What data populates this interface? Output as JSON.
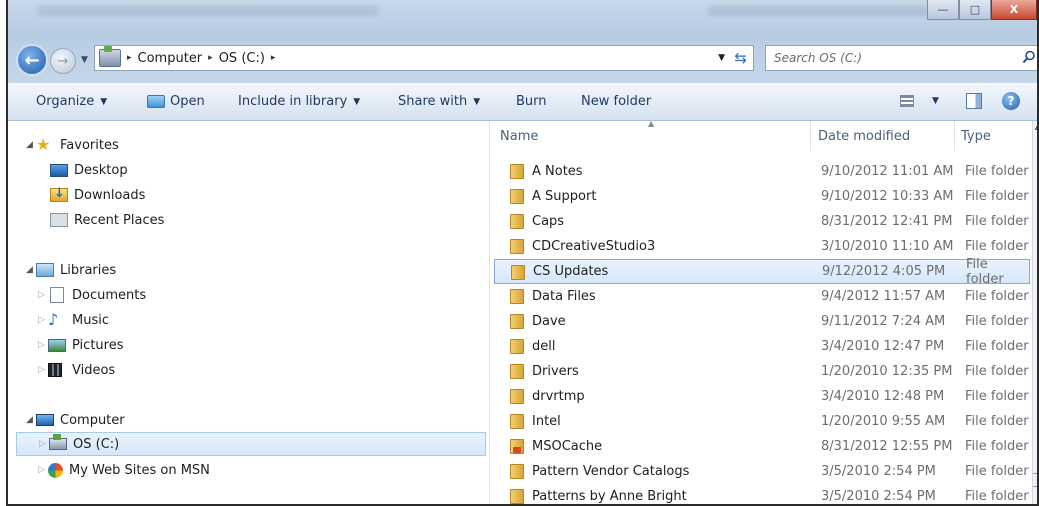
{
  "window": {
    "controls": {
      "minimize": "—",
      "maximize": "□",
      "close": "X"
    }
  },
  "address": {
    "breadcrumbs": [
      "Computer",
      "OS (C:)"
    ],
    "separator": "▸",
    "history_drop": "▼",
    "dropdown": "▼",
    "refresh": "⇆"
  },
  "search": {
    "placeholder": "Search OS (C:)"
  },
  "toolbar": {
    "organize": "Organize",
    "open": "Open",
    "include_in_library": "Include in library",
    "share_with": "Share with",
    "burn": "Burn",
    "new_folder": "New folder",
    "dropdown_arrow": "▼",
    "help": "?"
  },
  "navigation": {
    "favorites": {
      "label": "Favorites",
      "items": [
        "Desktop",
        "Downloads",
        "Recent Places"
      ]
    },
    "libraries": {
      "label": "Libraries",
      "items": [
        "Documents",
        "Music",
        "Pictures",
        "Videos"
      ]
    },
    "computer": {
      "label": "Computer",
      "items": [
        "OS (C:)",
        "My Web Sites on MSN"
      ]
    },
    "expanded_glyph": "◢",
    "collapsed_glyph": "▷"
  },
  "columns": {
    "name": "Name",
    "date_modified": "Date modified",
    "type": "Type"
  },
  "files": [
    {
      "name": "A Notes",
      "date": "9/10/2012 11:01 AM",
      "type": "File folder"
    },
    {
      "name": "A Support",
      "date": "9/10/2012 10:33 AM",
      "type": "File folder"
    },
    {
      "name": "Caps",
      "date": "8/31/2012 12:41 PM",
      "type": "File folder"
    },
    {
      "name": "CDCreativeStudio3",
      "date": "3/10/2010 11:10 AM",
      "type": "File folder"
    },
    {
      "name": "CS Updates",
      "date": "9/12/2012 4:05 PM",
      "type": "File folder",
      "selected": true
    },
    {
      "name": "Data Files",
      "date": "9/4/2012 11:57 AM",
      "type": "File folder"
    },
    {
      "name": "Dave",
      "date": "9/11/2012 7:24 AM",
      "type": "File folder"
    },
    {
      "name": "dell",
      "date": "3/4/2010 12:47 PM",
      "type": "File folder"
    },
    {
      "name": "Drivers",
      "date": "1/20/2010 12:35 PM",
      "type": "File folder"
    },
    {
      "name": "drvrtmp",
      "date": "3/4/2010 12:48 PM",
      "type": "File folder"
    },
    {
      "name": "Intel",
      "date": "1/20/2010 9:55 AM",
      "type": "File folder"
    },
    {
      "name": "MSOCache",
      "date": "8/31/2012 12:55 PM",
      "type": "File folder",
      "locked": true
    },
    {
      "name": "Pattern Vendor Catalogs",
      "date": "3/5/2010 2:54 PM",
      "type": "File folder"
    },
    {
      "name": "Patterns by Anne Bright",
      "date": "3/5/2010 2:54 PM",
      "type": "File folder"
    }
  ]
}
